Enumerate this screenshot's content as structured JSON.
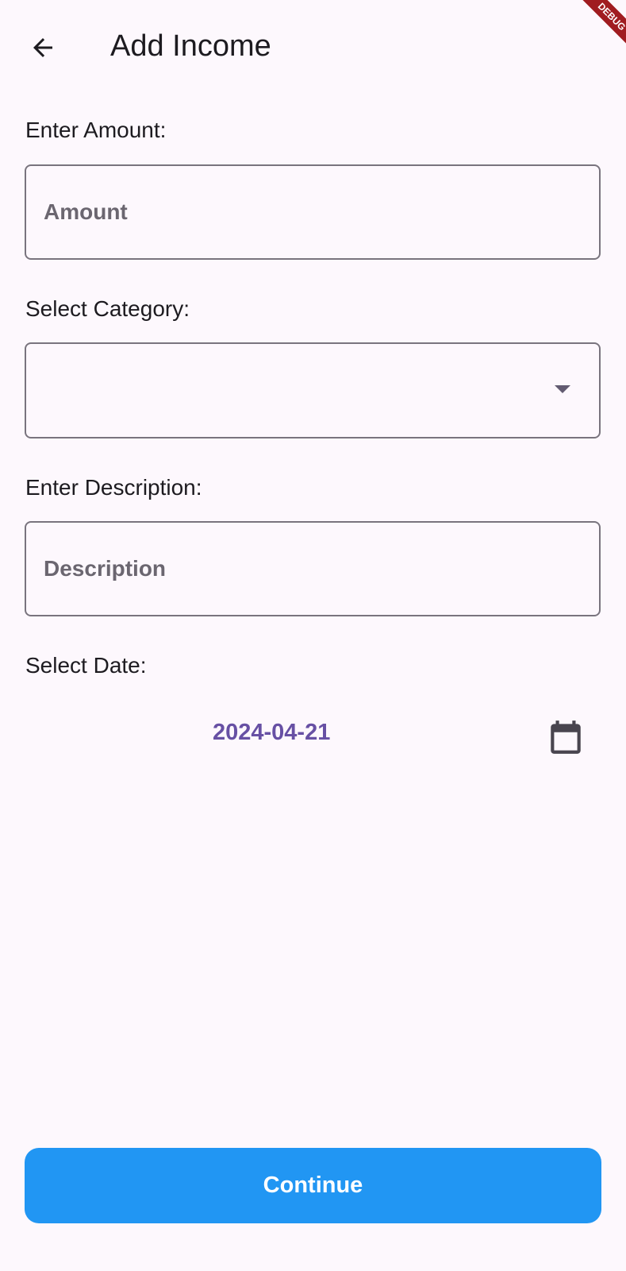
{
  "app_bar": {
    "title": "Add Income",
    "back_icon": "arrow-back-icon"
  },
  "debug_banner": {
    "label": "DEBUG",
    "color": "#a01c20"
  },
  "form": {
    "amount_label": "Enter Amount:",
    "amount_placeholder": "Amount",
    "amount_value": "",
    "category_label": "Select Category:",
    "category_value": "",
    "category_icon": "dropdown-arrow-icon",
    "description_label": "Enter Description:",
    "description_placeholder": "Description",
    "description_value": "",
    "date_label": "Select Date:",
    "date_value": "2024-04-21",
    "calendar_icon": "calendar-icon"
  },
  "actions": {
    "continue_label": "Continue"
  },
  "colors": {
    "background": "#fdf8fd",
    "accent": "#6750a4",
    "primary_button": "#2196f3",
    "outline": "#79747e"
  }
}
